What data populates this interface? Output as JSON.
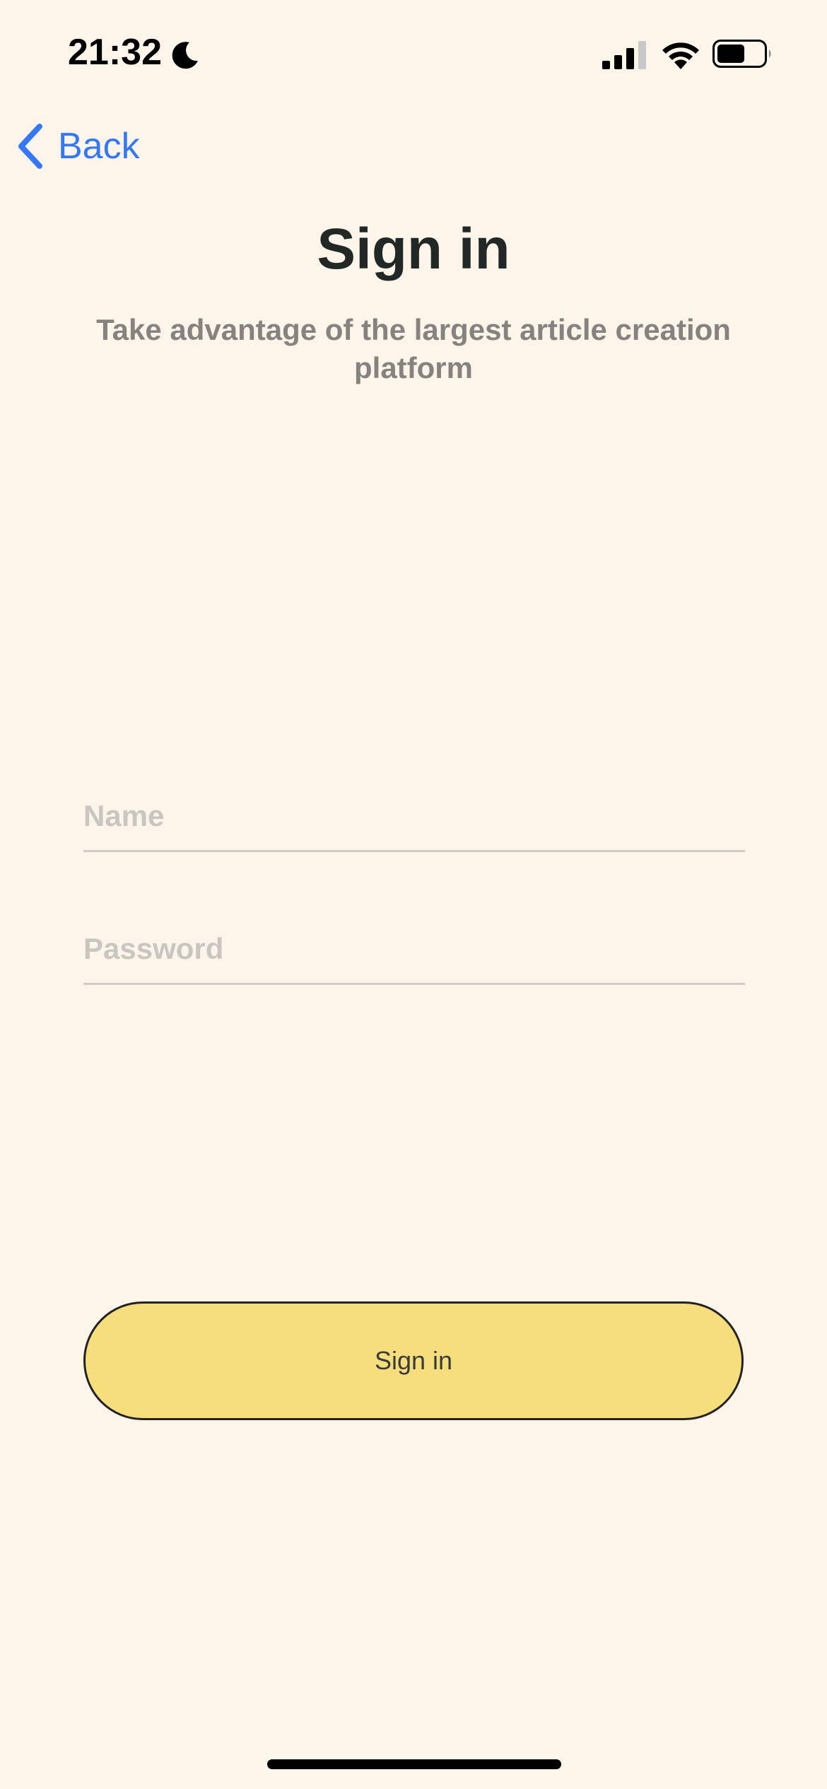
{
  "status_bar": {
    "time": "21:32",
    "icons": [
      "moon-icon",
      "cellular-signal-icon",
      "wifi-icon",
      "battery-icon"
    ]
  },
  "nav": {
    "back_label": "Back",
    "back_icon": "chevron-left-icon"
  },
  "header": {
    "title": "Sign in",
    "subtitle": "Take advantage of the largest article creation platform"
  },
  "form": {
    "name_placeholder": "Name",
    "name_value": "",
    "password_placeholder": "Password",
    "password_value": ""
  },
  "actions": {
    "signin_label": "Sign in"
  },
  "colors": {
    "background": "#fdf5e9",
    "accent_link": "#3478f6",
    "button_fill": "#f7de7d",
    "title_text": "#222826",
    "subtitle_text": "#858280"
  }
}
